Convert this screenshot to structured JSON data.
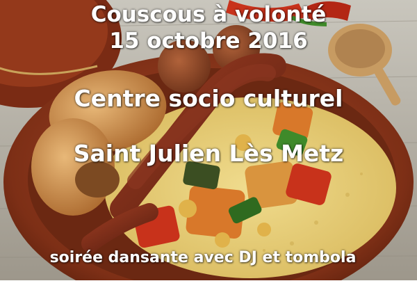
{
  "poster": {
    "line1": "Couscous à volonté",
    "line2": "15 octobre 2016",
    "line3": "Centre socio culturel",
    "line4": "Saint Julien Lès Metz",
    "line5": "soirée dansante avec DJ et tombola"
  },
  "colors": {
    "text": "#ffffff",
    "wood": "#b9b6ad",
    "tagine_clay": "#8e3a1c",
    "couscous": "#e8cf7a",
    "sausage": "#7a2d1a",
    "chicken": "#c98a3f",
    "pepper_red": "#c8321b",
    "pumpkin": "#d8782a",
    "herb_green": "#3f8a2a"
  },
  "icons": {
    "photo": "couscous-dish-illustration"
  }
}
